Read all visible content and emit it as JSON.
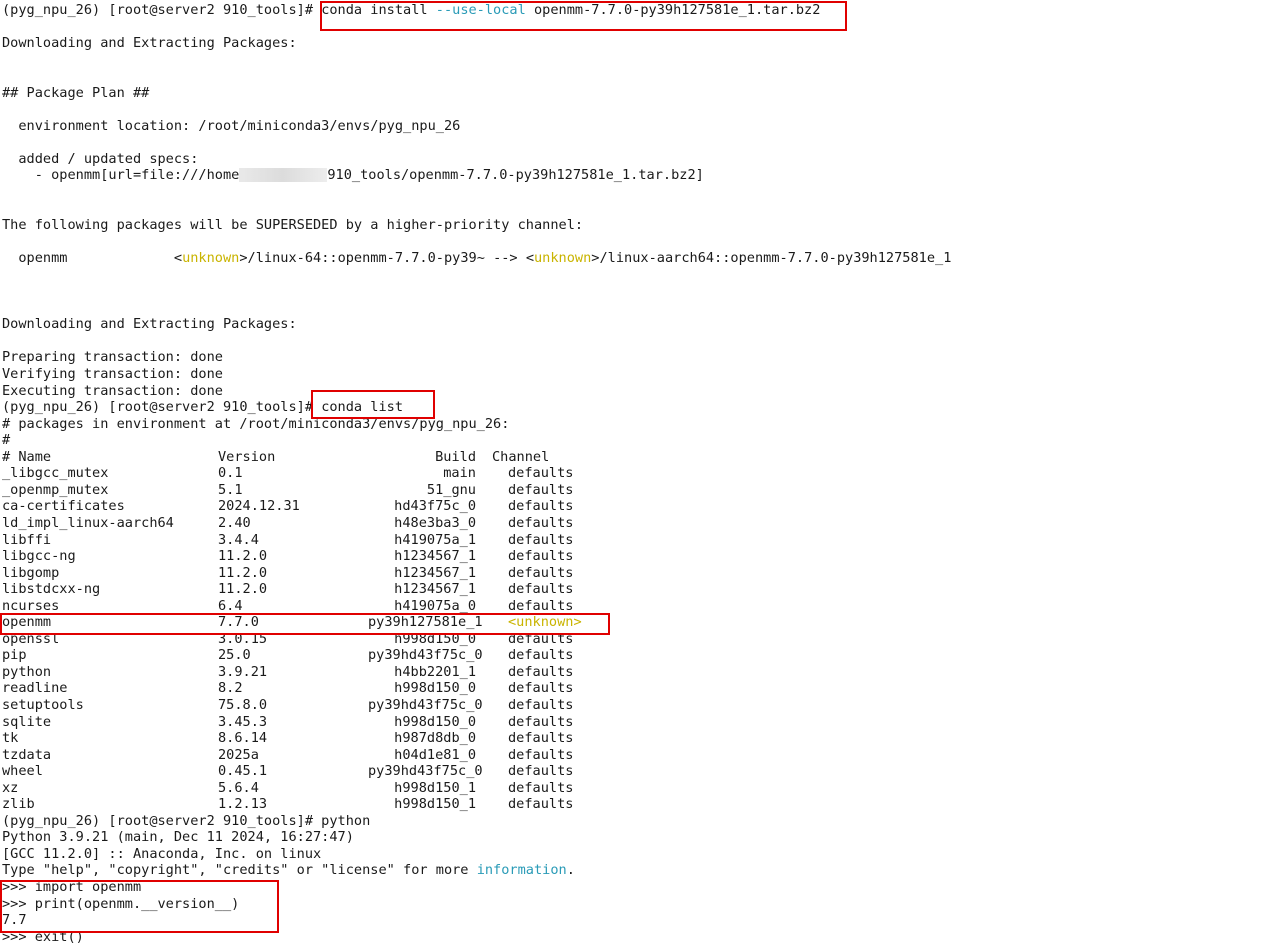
{
  "terminal": {
    "prompt1": "(pyg_npu_26) [root@server2 910_tools]# ",
    "install_cmd_a": "conda install ",
    "install_cmd_flag": "--use-local",
    "install_cmd_b": " openmm-7.7.0-py39h127581e_1.tar.bz2",
    "downloading1": "Downloading and Extracting Packages:",
    "plan_header": "## Package Plan ##",
    "env_location": "  environment location: /root/miniconda3/envs/pyg_npu_26",
    "specs_header": "  added / updated specs:",
    "spec_a": "    - openmm[url=file:///home",
    "spec_b": "910_tools/openmm-7.7.0-py39h127581e_1.tar.bz2]",
    "superseded": "The following packages will be SUPERSEDED by a higher-priority channel:",
    "sup_pkg": "  openmm             ",
    "sup_lt1": "<",
    "sup_unknown1": "unknown",
    "sup_mid": ">/linux-64::openmm-7.7.0-py39~ --> ",
    "sup_lt2": "<",
    "sup_unknown2": "unknown",
    "sup_end": ">/linux-aarch64::openmm-7.7.0-py39h127581e_1",
    "downloading2": "Downloading and Extracting Packages:",
    "preparing": "Preparing transaction: done",
    "verifying": "Verifying transaction: done",
    "executing": "Executing transaction: done",
    "prompt2": "(pyg_npu_26) [root@server2 910_tools]# ",
    "list_cmd": "conda list",
    "packages_in": "# packages in environment at /root/miniconda3/envs/pyg_npu_26:",
    "hash_line": "#",
    "header": {
      "name": "# Name",
      "version": "Version",
      "build": "Build",
      "channel": "Channel"
    },
    "packages": [
      {
        "name": "_libgcc_mutex",
        "version": "0.1",
        "build": "main",
        "channel": "defaults"
      },
      {
        "name": "_openmp_mutex",
        "version": "5.1",
        "build": "51_gnu",
        "channel": "defaults"
      },
      {
        "name": "ca-certificates",
        "version": "2024.12.31",
        "build": "hd43f75c_0",
        "channel": "defaults"
      },
      {
        "name": "ld_impl_linux-aarch64",
        "version": "2.40",
        "build": "h48e3ba3_0",
        "channel": "defaults"
      },
      {
        "name": "libffi",
        "version": "3.4.4",
        "build": "h419075a_1",
        "channel": "defaults"
      },
      {
        "name": "libgcc-ng",
        "version": "11.2.0",
        "build": "h1234567_1",
        "channel": "defaults"
      },
      {
        "name": "libgomp",
        "version": "11.2.0",
        "build": "h1234567_1",
        "channel": "defaults"
      },
      {
        "name": "libstdcxx-ng",
        "version": "11.2.0",
        "build": "h1234567_1",
        "channel": "defaults"
      },
      {
        "name": "ncurses",
        "version": "6.4",
        "build": "h419075a_0",
        "channel": "defaults"
      },
      {
        "name": "openmm",
        "version": "7.7.0",
        "build": "py39h127581e_1",
        "channel": "<unknown>"
      },
      {
        "name": "openssl",
        "version": "3.0.15",
        "build": "h998d150_0",
        "channel": "defaults"
      },
      {
        "name": "pip",
        "version": "25.0",
        "build": "py39hd43f75c_0",
        "channel": "defaults"
      },
      {
        "name": "python",
        "version": "3.9.21",
        "build": "h4bb2201_1",
        "channel": "defaults"
      },
      {
        "name": "readline",
        "version": "8.2",
        "build": "h998d150_0",
        "channel": "defaults"
      },
      {
        "name": "setuptools",
        "version": "75.8.0",
        "build": "py39hd43f75c_0",
        "channel": "defaults"
      },
      {
        "name": "sqlite",
        "version": "3.45.3",
        "build": "h998d150_0",
        "channel": "defaults"
      },
      {
        "name": "tk",
        "version": "8.6.14",
        "build": "h987d8db_0",
        "channel": "defaults"
      },
      {
        "name": "tzdata",
        "version": "2025a",
        "build": "h04d1e81_0",
        "channel": "defaults"
      },
      {
        "name": "wheel",
        "version": "0.45.1",
        "build": "py39hd43f75c_0",
        "channel": "defaults"
      },
      {
        "name": "xz",
        "version": "5.6.4",
        "build": "h998d150_1",
        "channel": "defaults"
      },
      {
        "name": "zlib",
        "version": "1.2.13",
        "build": "h998d150_1",
        "channel": "defaults"
      }
    ],
    "prompt3": "(pyg_npu_26) [root@server2 910_tools]# python",
    "py_version": "Python 3.9.21 (main, Dec 11 2024, 16:27:47)",
    "gcc_line": "[GCC 11.2.0] :: Anaconda, Inc. on linux",
    "type_help_a": "Type \"help\", \"copyright\", \"credits\" or \"license\" for more ",
    "type_help_link": "information",
    "type_help_b": ".",
    "py_import": ">>> import openmm",
    "py_print": ">>> print(openmm.__version__)",
    "py_result": "7.7",
    "py_exit": ">>> exit()"
  },
  "colors": {
    "highlight_box": "#e00000",
    "flag": "#2a9bb7",
    "unknown": "#c9b400"
  }
}
